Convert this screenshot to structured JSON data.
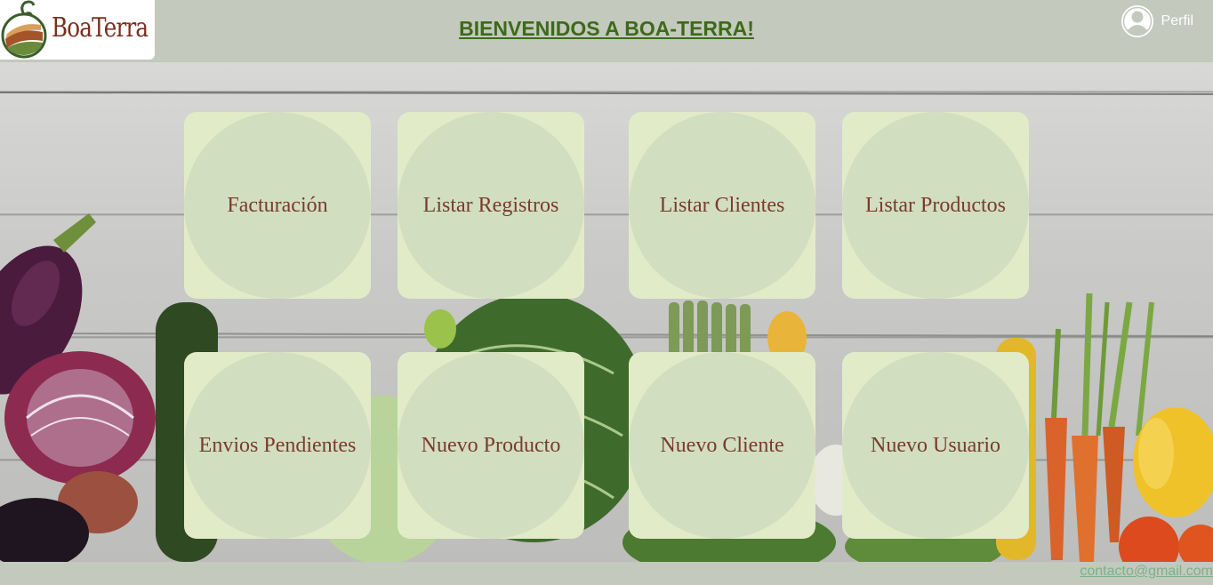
{
  "header": {
    "logo_text": "BoaTerra",
    "title": "BIENVENIDOS A BOA-TERRA!",
    "profile_label": "Perfil"
  },
  "tiles": [
    {
      "label": "Facturación"
    },
    {
      "label": "Listar Registros"
    },
    {
      "label": "Listar Clientes"
    },
    {
      "label": "Listar Productos"
    },
    {
      "label": "Envios Pendientes"
    },
    {
      "label": "Nuevo Producto"
    },
    {
      "label": "Nuevo Cliente"
    },
    {
      "label": "Nuevo Usuario"
    }
  ],
  "footer": {
    "contact_email": "contacto@gmail.com"
  },
  "colors": {
    "header_bg": "#c3c9bd",
    "title": "#3d6a1a",
    "tile_bg": "#e2ebc8",
    "tile_circle": "#d2dec0",
    "tile_text": "#7b3b2c",
    "footer_link": "#7ab28a"
  },
  "icons": {
    "profile": "user-avatar-icon",
    "logo": "boaterra-logo"
  }
}
